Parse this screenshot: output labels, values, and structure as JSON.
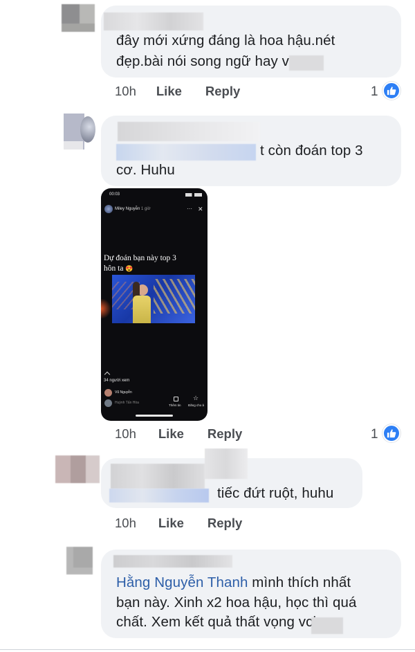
{
  "comments": [
    {
      "lines": [
        "đây mới xứng đáng là hoa hậu.nét",
        "đẹp.bài nói song ngữ hay v"
      ],
      "time": "10h",
      "like_label": "Like",
      "reply_label": "Reply",
      "like_count": "1"
    },
    {
      "lines_end": "t còn đoán top 3",
      "line2": "cơ. Huhu",
      "story": {
        "status_time": "00:03",
        "user": "Miley Nguyễn",
        "ago": "1 giờ",
        "menu": "···",
        "close": "✕",
        "caption_line1": "Dự đoán bạn này top 3",
        "caption_line2": "hôn ta",
        "emoji": "😍",
        "views": "34 người xem",
        "viewer1": "Vũ Nguyễn",
        "viewer2": "Huỳnh Tấn Hòa",
        "btn1": "Thêm tin",
        "btn2": "Đăng cho ả"
      },
      "time": "10h",
      "like_label": "Like",
      "reply_label": "Reply",
      "like_count": "1"
    },
    {
      "text": "tiếc đứt ruột, huhu",
      "time": "10h",
      "like_label": "Like",
      "reply_label": "Reply"
    },
    {
      "mention": "Hằng Nguyễn Thanh",
      "line1_rest": " mình thích nhất",
      "line2": "bạn này. Xinh x2 hoa hậu, học thì quá",
      "line3": "chất. Xem kết quả thất vọng vcic"
    }
  ],
  "colors": {
    "bubble": "#f0f2f5",
    "mention": "#2d5ea8",
    "like_blue": "#2d7ff5"
  },
  "icons": [
    "thumbs-up-icon",
    "close-icon",
    "more-icon"
  ]
}
